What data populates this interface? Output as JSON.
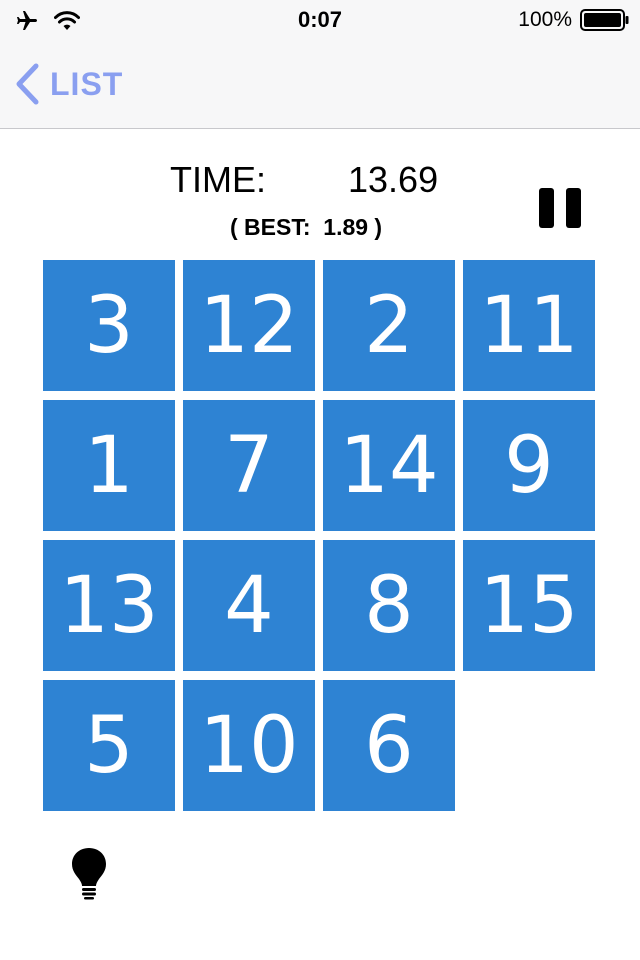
{
  "status_bar": {
    "time": "0:07",
    "battery_percent": "100%",
    "icons": [
      "airplane-icon",
      "wifi-icon",
      "battery-icon"
    ]
  },
  "nav": {
    "back_label": "LIST",
    "back_icon": "chevron-left-icon",
    "accent_color": "#8a9ff0"
  },
  "timer": {
    "label": "TIME:",
    "value": "13.69",
    "best_text": "( BEST:  1.89 )"
  },
  "controls": {
    "pause_icon": "pause-icon",
    "hint_icon": "lightbulb-icon"
  },
  "board": {
    "tile_color": "#2e83d3",
    "tiles": [
      {
        "label": "3"
      },
      {
        "label": "12"
      },
      {
        "label": "2"
      },
      {
        "label": "11"
      },
      {
        "label": "1"
      },
      {
        "label": "7"
      },
      {
        "label": "14"
      },
      {
        "label": "9"
      },
      {
        "label": "13"
      },
      {
        "label": "4"
      },
      {
        "label": "8"
      },
      {
        "label": "15"
      },
      {
        "label": "5"
      },
      {
        "label": "10"
      },
      {
        "label": "6"
      },
      {
        "label": ""
      }
    ]
  }
}
